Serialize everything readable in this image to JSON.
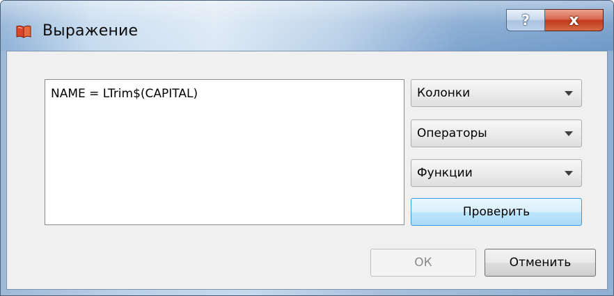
{
  "window": {
    "title": "Выражение",
    "help_label": "?",
    "close_label": "x"
  },
  "expression": {
    "value": "NAME = LTrim$(CAPITAL)"
  },
  "dropdowns": {
    "columns": "Колонки",
    "operators": "Операторы",
    "functions": "Функции"
  },
  "buttons": {
    "check": "Проверить",
    "ok": "ОК",
    "cancel": "Отменить",
    "ok_enabled": false
  },
  "icons": {
    "app": "red-book-icon",
    "combo_arrow": "chevron-down-icon"
  },
  "colors": {
    "close_button": "#c2391c",
    "check_button_accent": "#3c9ae0",
    "app_icon": "#d9462a"
  }
}
